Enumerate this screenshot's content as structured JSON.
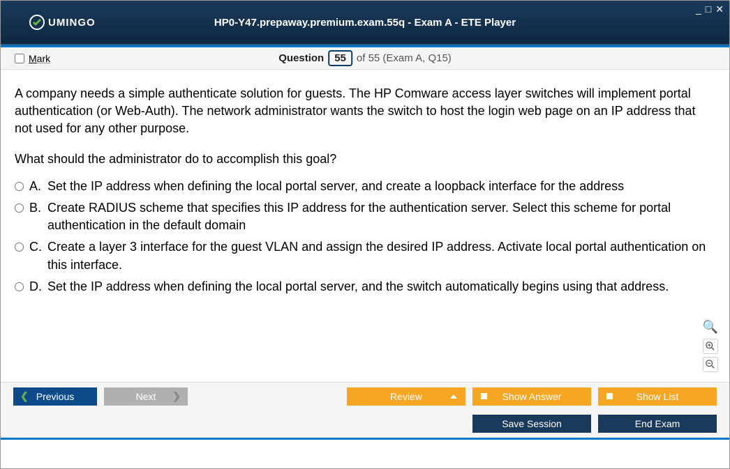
{
  "window": {
    "title": "HP0-Y47.prepaway.premium.exam.55q - Exam A - ETE Player",
    "brand": "UMINGO",
    "minimize": "_",
    "maximize": "□",
    "close": "✕"
  },
  "toolbar": {
    "mark_label": "Mark",
    "question_label": "Question",
    "current_num": "55",
    "total_text": "of 55 (Exam A, Q15)"
  },
  "question": {
    "body": "A company needs a simple authenticate solution for guests. The HP Comware access layer switches will implement portal authentication (or Web-Auth). The network administrator wants the switch to host the login web page on an IP address that not used for any other purpose.",
    "prompt": "What should the administrator do to accomplish this goal?",
    "options": [
      {
        "letter": "A.",
        "text": "Set the IP address when defining the local portal server, and create a loopback interface for the address"
      },
      {
        "letter": "B.",
        "text": "Create RADIUS scheme that specifies this IP address for the authentication server. Select this scheme for portal authentication in the default domain"
      },
      {
        "letter": "C.",
        "text": "Create a layer 3 interface for the guest VLAN and assign the desired IP address. Activate local portal authentication on this interface."
      },
      {
        "letter": "D.",
        "text": "Set the IP address when defining the local portal server, and the switch automatically begins using that address."
      }
    ]
  },
  "buttons": {
    "previous": "Previous",
    "next": "Next",
    "review": "Review",
    "show_answer": "Show Answer",
    "show_list": "Show List",
    "save_session": "Save Session",
    "end_exam": "End Exam"
  }
}
